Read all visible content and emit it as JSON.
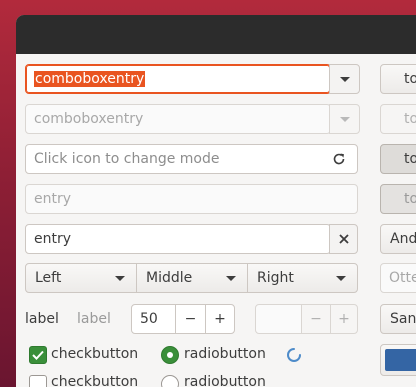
{
  "combo_entry_1": {
    "value": "comboboxentry"
  },
  "combo_entry_2": {
    "value": "comboboxentry"
  },
  "icon_entry": {
    "placeholder": "Click icon to change mode"
  },
  "disabled_entry": {
    "placeholder": "entry"
  },
  "clear_entry": {
    "value": "entry"
  },
  "segmented": {
    "left": "Left",
    "middle": "Middle",
    "right": "Right"
  },
  "labels": {
    "label_1": "label",
    "label_2": "label"
  },
  "spin": {
    "value": "50",
    "minus": "−",
    "plus": "+"
  },
  "spin_disabled": {
    "minus": "−",
    "plus": "+"
  },
  "checks": {
    "check_1": "checkbutton",
    "check_2": "checkbutton"
  },
  "radios": {
    "radio_1": "radiobutton",
    "radio_2": "radiobutton"
  },
  "right_column": {
    "button_1": "to",
    "button_2": "to",
    "toggle_1": "to",
    "toggle_2": "to",
    "combo": "And",
    "entry_placeholder": "Otte",
    "button_3": "San"
  },
  "colors": {
    "accent": "#e95420",
    "check_green": "#3a8f3a",
    "spinner_blue": "#3c7fc4",
    "swatch": "#3465a4"
  }
}
